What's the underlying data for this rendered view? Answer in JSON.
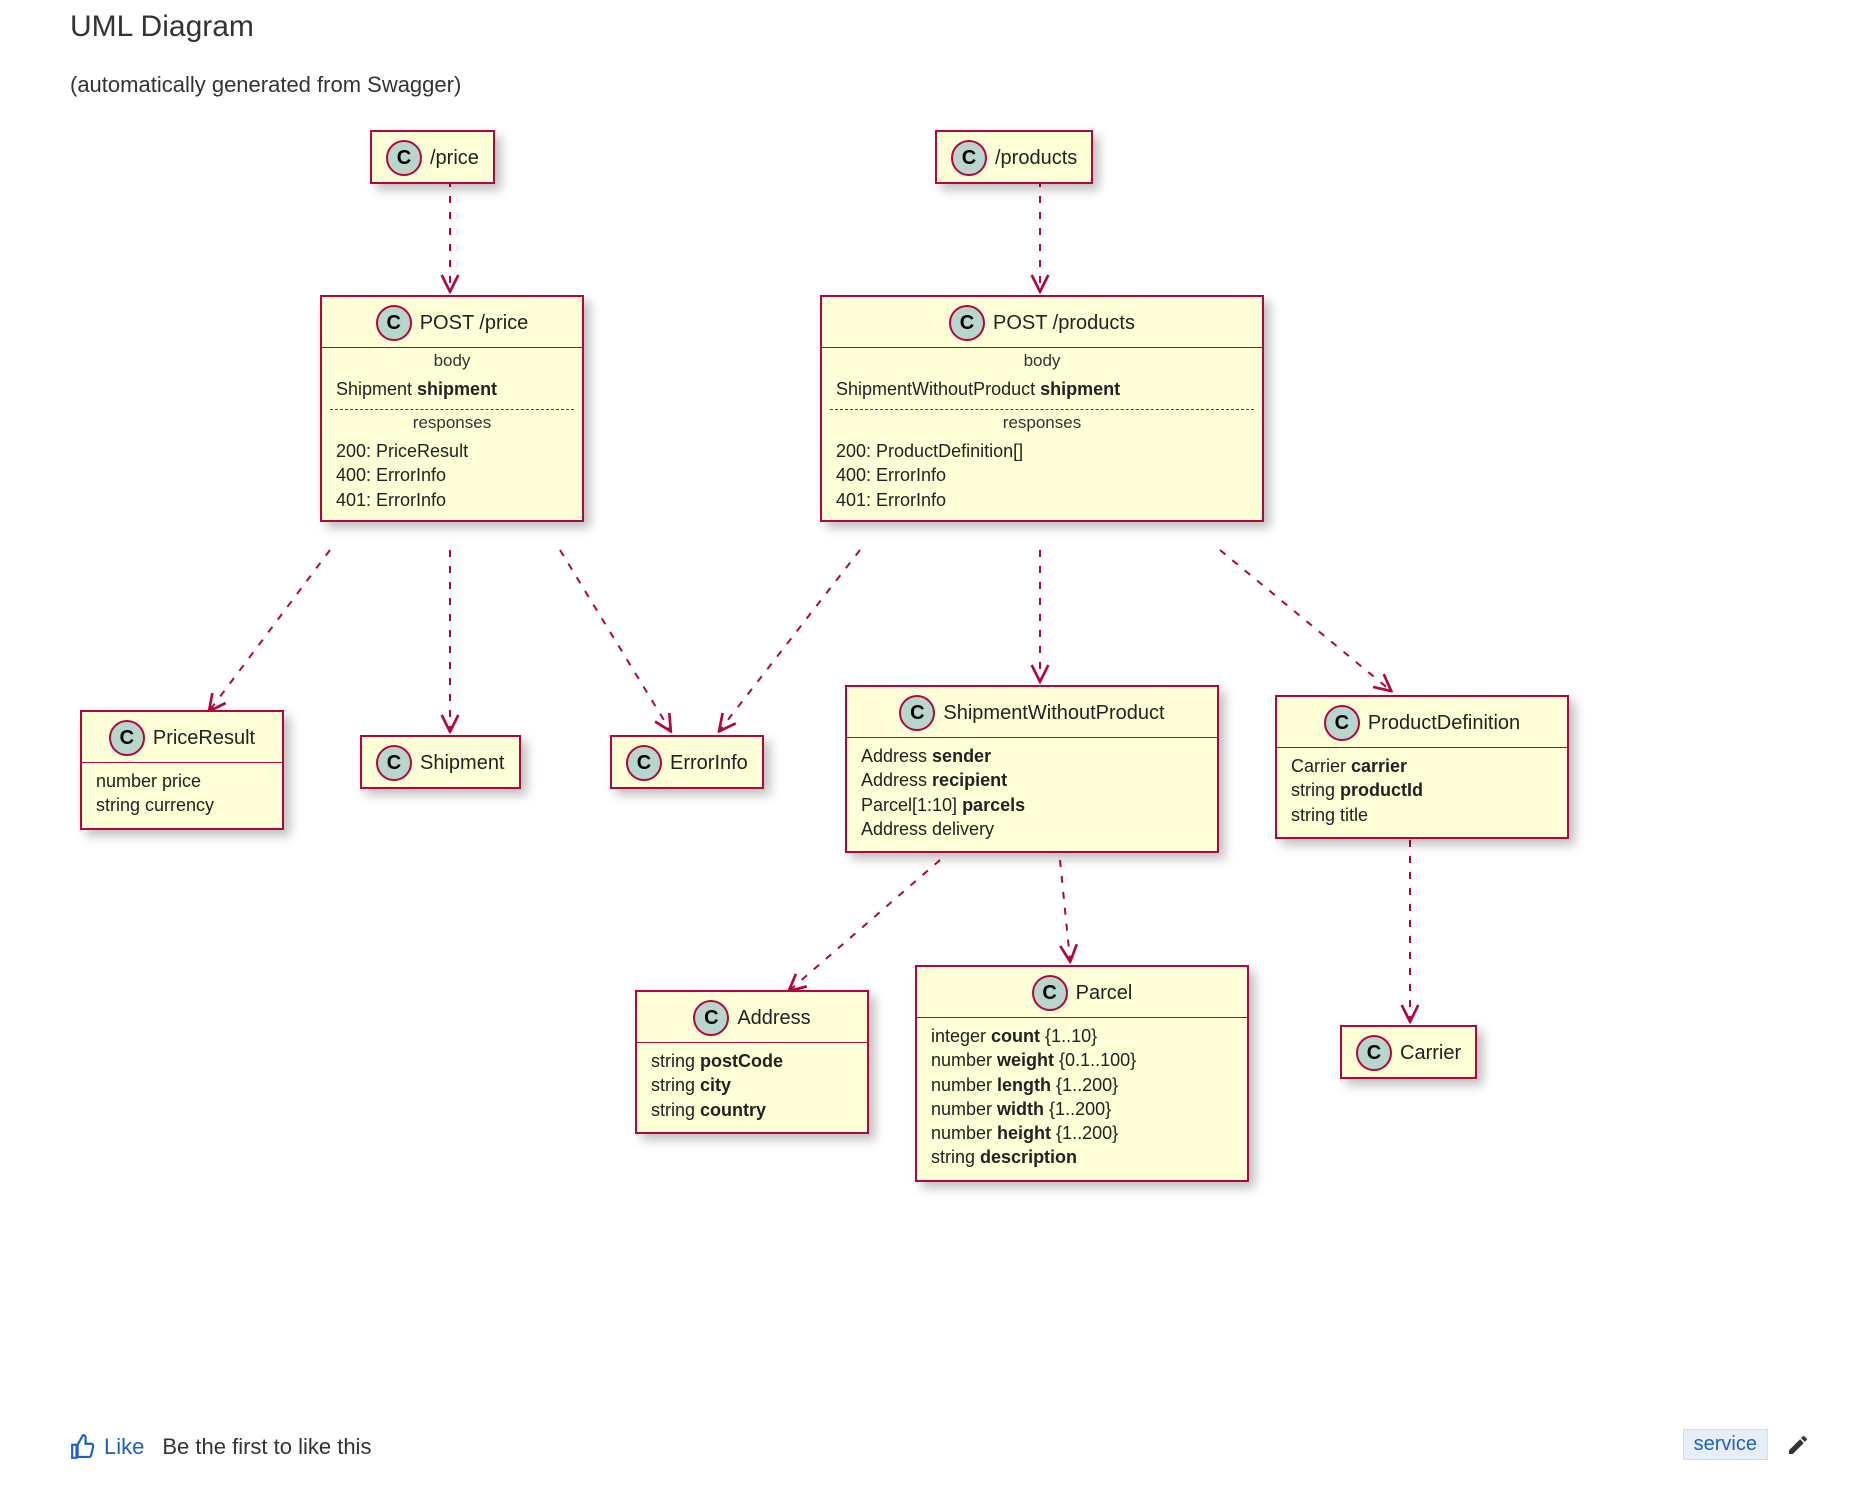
{
  "heading": "UML Diagram",
  "subhead": "(automatically generated from Swagger)",
  "classes": {
    "priceRoot": {
      "name": "/price"
    },
    "productsRoot": {
      "name": "/products"
    },
    "postPrice": {
      "name": "POST /price",
      "bodyLabel": "body",
      "body": [
        "Shipment shipment"
      ],
      "respLabel": "responses",
      "responses": [
        "200: PriceResult",
        "400: ErrorInfo",
        "401: ErrorInfo"
      ]
    },
    "postProducts": {
      "name": "POST /products",
      "bodyLabel": "body",
      "body": [
        "ShipmentWithoutProduct shipment"
      ],
      "respLabel": "responses",
      "responses": [
        "200: ProductDefinition[]",
        "400: ErrorInfo",
        "401: ErrorInfo"
      ]
    },
    "priceResult": {
      "name": "PriceResult",
      "fields": [
        "number price",
        "string currency"
      ]
    },
    "shipment": {
      "name": "Shipment"
    },
    "errorInfo": {
      "name": "ErrorInfo"
    },
    "swp": {
      "name": "ShipmentWithoutProduct",
      "fields": [
        "Address sender",
        "Address recipient",
        "Parcel[1:10] parcels",
        "Address delivery"
      ]
    },
    "productDef": {
      "name": "ProductDefinition",
      "fields": [
        "Carrier carrier",
        "string productId",
        "string title"
      ]
    },
    "address": {
      "name": "Address",
      "fields": [
        "string postCode",
        "string city",
        "string country"
      ]
    },
    "parcel": {
      "name": "Parcel",
      "fields": [
        "integer count {1..10}",
        "number weight {0.1..100}",
        "number length {1..200}",
        "number width {1..200}",
        "number height {1..200}",
        "string description"
      ]
    },
    "carrier": {
      "name": "Carrier"
    }
  },
  "footer": {
    "like": "Like",
    "be_first": "Be the first to like this",
    "tag": "service"
  },
  "edges": [
    {
      "from": "priceRoot",
      "to": "postPrice",
      "style": "dash"
    },
    {
      "from": "productsRoot",
      "to": "postProducts",
      "style": "dash"
    },
    {
      "from": "postPrice",
      "to": "priceResult",
      "style": "dash"
    },
    {
      "from": "postPrice",
      "to": "shipment",
      "style": "dash"
    },
    {
      "from": "postPrice",
      "to": "errorInfo",
      "style": "dash"
    },
    {
      "from": "postProducts",
      "to": "errorInfo",
      "style": "dash"
    },
    {
      "from": "postProducts",
      "to": "swp",
      "style": "dash"
    },
    {
      "from": "postProducts",
      "to": "productDef",
      "style": "dash"
    },
    {
      "from": "swp",
      "to": "address",
      "style": "dash"
    },
    {
      "from": "swp",
      "to": "parcel",
      "style": "dash"
    },
    {
      "from": "productDef",
      "to": "carrier",
      "style": "dash"
    }
  ]
}
